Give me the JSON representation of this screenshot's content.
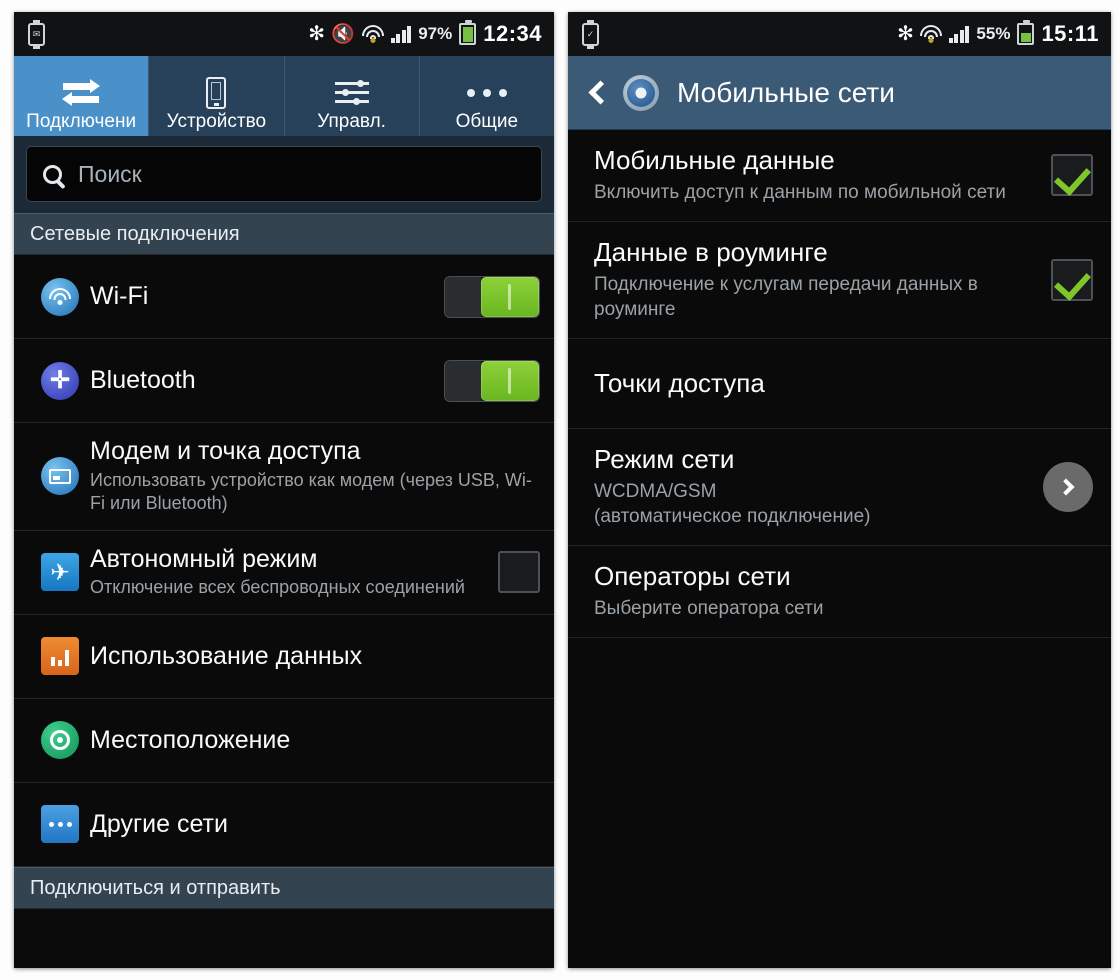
{
  "left_phone": {
    "statusbar": {
      "watch_icon": "watch-icon",
      "bluetooth_icon": "bluetooth-icon",
      "mute_icon": "mute-icon",
      "wifi_icon": "wifi-icon",
      "signal_icon": "signal-bars-icon",
      "battery_percent": "97%",
      "battery_icon": "battery-icon",
      "clock": "12:34"
    },
    "tabs": [
      {
        "label": "Подключени",
        "icon": "swap-arrows-icon",
        "active": true
      },
      {
        "label": "Устройство",
        "icon": "phone-icon",
        "active": false
      },
      {
        "label": "Управл.",
        "icon": "sliders-icon",
        "active": false
      },
      {
        "label": "Общие",
        "icon": "more-dots-icon",
        "active": false
      }
    ],
    "search": {
      "placeholder": "Поиск",
      "icon": "search-icon"
    },
    "section_header": "Сетевые подключения",
    "rows": [
      {
        "title": "Wi-Fi",
        "sub": "",
        "icon": "wifi-icon",
        "control": "toggle-on"
      },
      {
        "title": "Bluetooth",
        "sub": "",
        "icon": "bluetooth-icon",
        "control": "toggle-on"
      },
      {
        "title": "Модем и точка доступа",
        "sub": "Использовать устройство как модем (через USB, Wi-Fi или Bluetooth)",
        "icon": "tethering-icon",
        "control": "none"
      },
      {
        "title": "Автономный режим",
        "sub": "Отключение всех беспроводных соединений",
        "icon": "airplane-icon",
        "control": "checkbox-off"
      },
      {
        "title": "Использование данных",
        "sub": "",
        "icon": "data-usage-icon",
        "control": "none"
      },
      {
        "title": "Местоположение",
        "sub": "",
        "icon": "location-icon",
        "control": "none"
      },
      {
        "title": "Другие сети",
        "sub": "",
        "icon": "other-networks-icon",
        "control": "none"
      }
    ],
    "bottom_section_header": "Подключиться и отправить"
  },
  "right_phone": {
    "statusbar": {
      "watch_icon": "watch-icon",
      "bluetooth_icon": "bluetooth-icon",
      "wifi_icon": "wifi-icon",
      "signal_icon": "signal-bars-icon",
      "battery_percent": "55%",
      "battery_icon": "battery-icon",
      "clock": "15:11"
    },
    "titlebar": {
      "back_icon": "back-chevron-icon",
      "app_icon": "settings-gear-icon",
      "title": "Мобильные сети"
    },
    "rows": [
      {
        "title": "Мобильные данные",
        "sub": "Включить доступ к данным по мобильной сети",
        "control": "checkbox-on"
      },
      {
        "title": "Данные в роуминге",
        "sub": "Подключение к услугам передачи данных в роуминге",
        "control": "checkbox-on"
      },
      {
        "title": "Точки доступа",
        "sub": "",
        "control": "none"
      },
      {
        "title": "Режим сети",
        "sub": "WCDMA/GSM\n(автоматическое подключение)",
        "control": "chevron"
      },
      {
        "title": "Операторы сети",
        "sub": "Выберите оператора сети",
        "control": "none"
      }
    ]
  },
  "colors": {
    "accent_blue": "#4a90c9",
    "titlebar_blue": "#3a5a76",
    "toggle_green": "#7fc62c",
    "background_black": "#0a0a0a"
  }
}
